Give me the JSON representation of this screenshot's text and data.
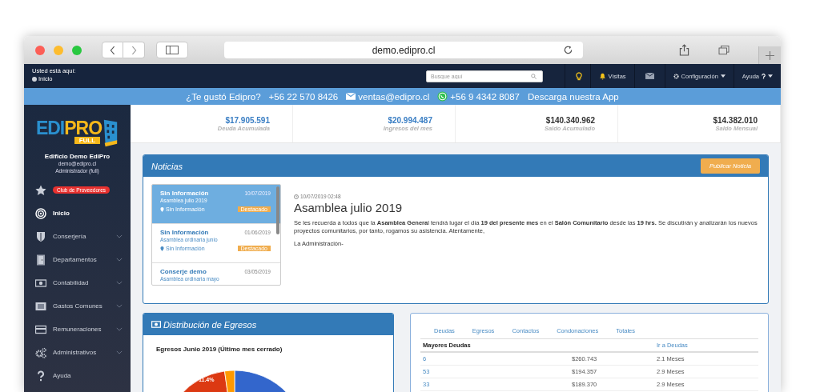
{
  "browser": {
    "url": "demo.edipro.cl"
  },
  "top_nav": {
    "breadcrumb_label": "Usted está aquí:",
    "breadcrumb": "Inicio",
    "search": {
      "placeholder": "Busque aquí"
    },
    "visits": "Visitas",
    "settings": "Configuración",
    "help": "Ayuda"
  },
  "banner": [
    {
      "kind": "text",
      "text": "¿Te gustó Edipro?"
    },
    {
      "kind": "text",
      "text": "+56 22 570 8426"
    },
    {
      "kind": "email",
      "text": "ventas@edipro.cl"
    },
    {
      "kind": "whatsapp",
      "text": "+56 9 4342 8087"
    },
    {
      "kind": "text",
      "text": "Descarga nuestra App"
    }
  ],
  "sidebar": {
    "logo": {
      "edi": "EDI",
      "pro": "PRO",
      "badge": "FULL"
    },
    "building": "Edificio Demo EdiPro",
    "email": "demo@edipro.cl",
    "role": "Administrador (full)",
    "items": [
      {
        "kind": "badge",
        "label": "Club de Proveedores",
        "selected": false,
        "has_submenu": false
      },
      {
        "kind": "link",
        "label": "Inicio",
        "selected": true,
        "has_submenu": false
      },
      {
        "kind": "link",
        "label": "Conserjería",
        "selected": false,
        "has_submenu": true
      },
      {
        "kind": "link",
        "label": "Departamentos",
        "selected": false,
        "has_submenu": true
      },
      {
        "kind": "link",
        "label": "Contabilidad",
        "selected": false,
        "has_submenu": true
      },
      {
        "kind": "link",
        "label": "Gastos Comunes",
        "selected": false,
        "has_submenu": true
      },
      {
        "kind": "link",
        "label": "Remuneraciones",
        "selected": false,
        "has_submenu": true
      },
      {
        "kind": "link",
        "label": "Administrativos",
        "selected": false,
        "has_submenu": true
      },
      {
        "kind": "link",
        "label": "Ayuda",
        "selected": false,
        "has_submenu": false
      }
    ]
  },
  "stats": [
    {
      "value": "$17.905.591",
      "label": "Deuda Acumulada",
      "highlight": true
    },
    {
      "value": "$20.994.487",
      "label": "Ingresos del mes",
      "highlight": true
    },
    {
      "value": "$140.340.962",
      "label": "Saldo Acumulado",
      "highlight": false
    },
    {
      "value": "$14.382.010",
      "label": "Saldo Mensual",
      "highlight": false
    }
  ],
  "news": {
    "title": "Noticias",
    "publish_button": "Publicar Noticia",
    "items": [
      {
        "title": "Sin Información",
        "date": "10/07/2019",
        "subtitle": "Asamblea julio 2019",
        "location": "Sin Información",
        "badge": "Destacado",
        "selected": true
      },
      {
        "title": "Sin Información",
        "date": "01/06/2019",
        "subtitle": "Asamblea ordinaria junio",
        "location": "Sin Información",
        "badge": "Destacado",
        "selected": false
      },
      {
        "title": "Conserje demo",
        "date": "03/05/2019",
        "subtitle": "Asamblea ordinaria mayo",
        "selected": false
      }
    ],
    "detail": {
      "timestamp": "10/07/2019 02:48",
      "heading": "Asamblea julio 2019",
      "body": "Se les recuerda a todos que la **Asamblea Genera**l tendrá lugar el día **19 del presente mes** en el **Salón Comunitario** desde las **19 hrs.** Se discutirán y analizarán los nuevos proyectos comunitarios, por tanto, rogamos su asistencia. Atentamente,",
      "signature": "La Administración-"
    }
  },
  "expenses": {
    "title": "Distribución de Egresos",
    "chart_title": "Egresos Junio 2019 (Último mes cerrado)",
    "slice_label": "11.4%"
  },
  "debts": {
    "tabs": [
      {
        "label": "Deudas",
        "selected": false
      },
      {
        "label": "Egresos",
        "selected": false
      },
      {
        "label": "Contactos",
        "selected": false
      },
      {
        "label": "Condonaciones",
        "selected": false
      },
      {
        "label": "Totales",
        "selected": false
      }
    ],
    "heading": "Mayores Deudas",
    "link": "Ir a Deudas",
    "rows": [
      {
        "unit": "6",
        "amount": "$260.743",
        "months": "2.1 Meses"
      },
      {
        "unit": "53",
        "amount": "$194.357",
        "months": "2.9 Meses"
      },
      {
        "unit": "33",
        "amount": "$189.370",
        "months": "2.9 Meses"
      }
    ]
  }
}
